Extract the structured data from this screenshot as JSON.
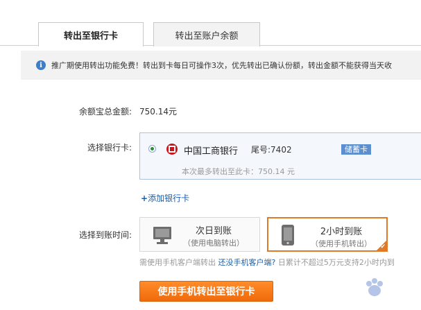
{
  "tabs": [
    {
      "label": "转出至银行卡",
      "active": true
    },
    {
      "label": "转出至账户余额",
      "active": false
    }
  ],
  "notice": {
    "icon": "info-icon",
    "text": "推广期使用转出功能免费！转出到卡每日可操作3次，优先转出已确认份额，转出金额不能获得当天收"
  },
  "balance": {
    "label": "余额宝总金额:",
    "value": "750.14元"
  },
  "bank_select": {
    "label": "选择银行卡:",
    "bank_name": "中国工商银行",
    "card_tail": "尾号:7402",
    "card_type": "储蓄卡",
    "max_hint": "本次最多转出至此卡：750.14 元",
    "add_card_plus": "+",
    "add_card_label": "添加银行卡"
  },
  "arrival": {
    "label": "选择到账时间:",
    "options": [
      {
        "title": "次日到账",
        "subtitle": "（使用电脑转出）",
        "icon": "monitor-icon",
        "selected": false
      },
      {
        "title": "2小时到账",
        "subtitle": "（使用手机转出）",
        "icon": "phone-icon",
        "selected": true
      }
    ],
    "footnote_prefix": "需使用手机客户端转出",
    "footnote_link": "还没手机客户端?",
    "footnote_suffix": "日累计不超过5万元支持2小时内到"
  },
  "submit_label": "使用手机转出至银行卡",
  "colors": {
    "accent_orange": "#f07a1a",
    "link_blue": "#1a5ea8",
    "badge_blue": "#5b8fcf",
    "bank_red": "#c8161d"
  }
}
